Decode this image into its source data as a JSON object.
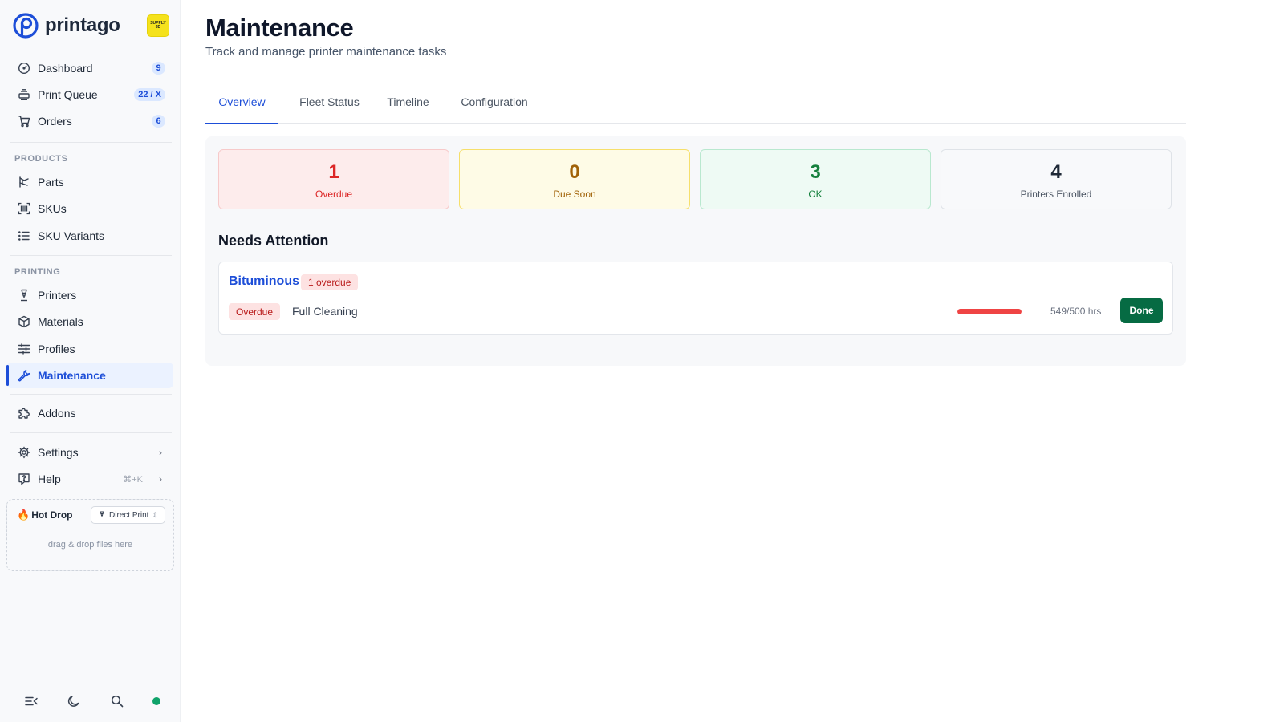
{
  "app": {
    "name": "printago"
  },
  "sidebar": {
    "nav": [
      {
        "label": "Dashboard",
        "icon": "dashboard-gauge-icon",
        "badge": "9"
      },
      {
        "label": "Print Queue",
        "icon": "print-queue-icon",
        "badge": "22 / X"
      },
      {
        "label": "Orders",
        "icon": "cart-icon",
        "badge": "6"
      }
    ],
    "products_label": "PRODUCTS",
    "products": [
      {
        "label": "Parts",
        "icon": "parts-icon"
      },
      {
        "label": "SKUs",
        "icon": "barcode-icon"
      },
      {
        "label": "SKU Variants",
        "icon": "list-icon"
      }
    ],
    "printing_label": "PRINTING",
    "printing": [
      {
        "label": "Printers",
        "icon": "printer-nozzle-icon"
      },
      {
        "label": "Materials",
        "icon": "box-icon"
      },
      {
        "label": "Profiles",
        "icon": "sliders-icon"
      },
      {
        "label": "Maintenance",
        "icon": "wrench-icon",
        "active": true
      }
    ],
    "addons": {
      "label": "Addons",
      "icon": "puzzle-icon"
    },
    "settings": {
      "label": "Settings",
      "icon": "gear-icon"
    },
    "help": {
      "label": "Help",
      "icon": "help-icon",
      "shortcut": "⌘+K"
    },
    "hot_drop": {
      "title": "Hot Drop",
      "mode": "Direct Print",
      "hint": "drag & drop files here"
    },
    "status_color": "#10a36a"
  },
  "header": {
    "title": "Maintenance",
    "subtitle": "Track and manage printer maintenance tasks"
  },
  "tabs": [
    {
      "label": "Overview",
      "active": true
    },
    {
      "label": "Fleet Status"
    },
    {
      "label": "Timeline"
    },
    {
      "label": "Configuration"
    }
  ],
  "stats": {
    "overdue": {
      "value": "1",
      "label": "Overdue"
    },
    "due_soon": {
      "value": "0",
      "label": "Due Soon"
    },
    "ok": {
      "value": "3",
      "label": "OK"
    },
    "enrolled": {
      "value": "4",
      "label": "Printers Enrolled"
    }
  },
  "needs_attention": {
    "heading": "Needs Attention",
    "items": [
      {
        "printer": "Bituminous",
        "count_badge": "1 overdue",
        "status": "Overdue",
        "task": "Full Cleaning",
        "progress_fraction": 1.0,
        "hours": "549/500 hrs",
        "action": "Done"
      }
    ]
  },
  "colors": {
    "accent": "#1d4ed8",
    "overdue": "#dc2626",
    "due_soon": "#a16207",
    "ok": "#15803d",
    "done_button": "#066b43"
  }
}
